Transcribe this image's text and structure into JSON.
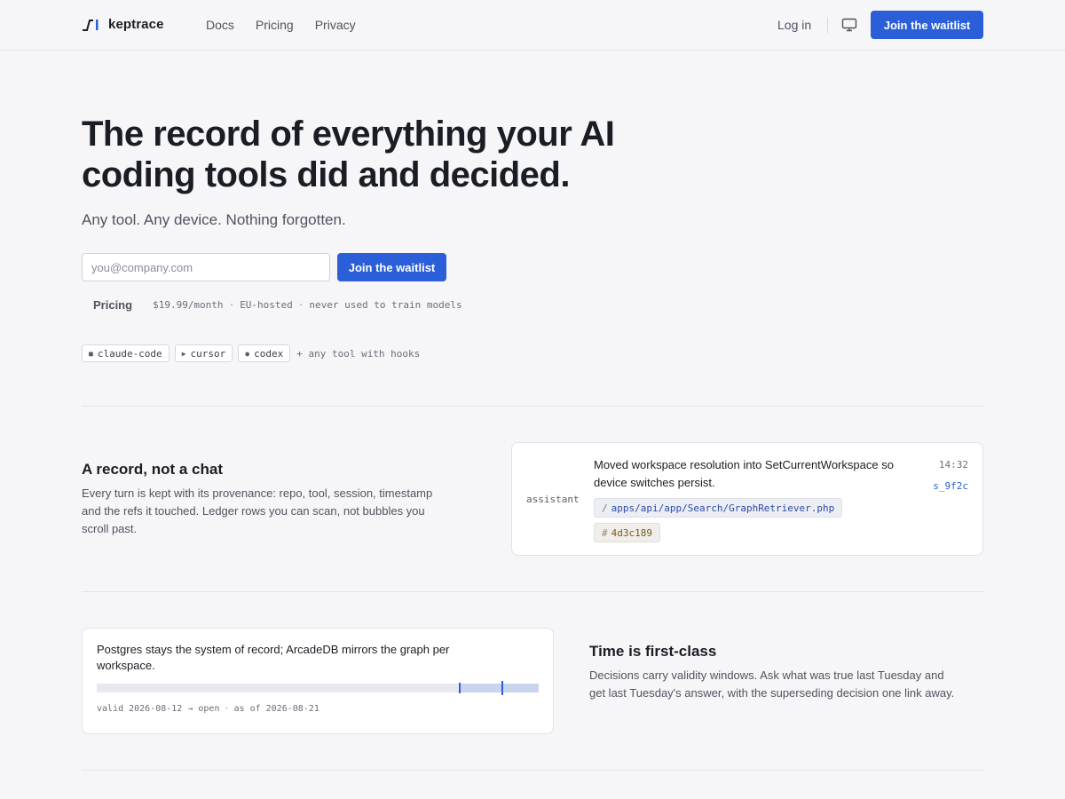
{
  "header": {
    "brand": "keptrace",
    "nav": [
      "Docs",
      "Pricing",
      "Privacy"
    ],
    "login": "Log in",
    "cta": "Join the waitlist"
  },
  "hero": {
    "title_line1": "The record of everything your AI",
    "title_line2": "coding tools did and decided.",
    "subtitle": "Any tool. Any device. Nothing forgotten.",
    "email_placeholder": "you@company.com",
    "cta": "Join the waitlist",
    "pricing_label": "Pricing",
    "pricing_items": [
      "$19.99/month",
      "EU-hosted",
      "never used to train models"
    ],
    "tools": [
      {
        "icon": "square-icon",
        "label": "claude-code"
      },
      {
        "icon": "play-icon",
        "label": "cursor"
      },
      {
        "icon": "circle-icon",
        "label": "codex"
      }
    ],
    "tools_extra": "+ any tool with hooks"
  },
  "section_record": {
    "title": "A record, not a chat",
    "body": "Every turn is kept with its provenance: repo, tool, session, timestamp and the refs it touched. Ledger rows you can scan, not bubbles you scroll past.",
    "card": {
      "role": "assistant",
      "message": "Moved workspace resolution into SetCurrentWorkspace so device switches persist.",
      "ref_path_prefix": "/",
      "ref_path": "apps/api/app/Search/GraphRetriever.php",
      "ref_hash_prefix": "#",
      "ref_hash": "4d3c189",
      "time": "14:32",
      "session": "s_9f2c"
    }
  },
  "section_time": {
    "title": "Time is first-class",
    "body": "Decisions carry validity windows. Ask what was true last Tuesday and get last Tuesday's answer, with the superseding decision one link away.",
    "card": {
      "text": "Postgres stays the system of record; ArcadeDB mirrors the graph per workspace.",
      "valid_text": "valid 2026-08-12 → open",
      "asof_text": "as of 2026-08-21",
      "validity_start_fraction": 0.822,
      "as_of_fraction": 0.918
    }
  },
  "colors": {
    "accent": "#2a5fd8",
    "background": "#f6f6f9",
    "text": "#1b1d24",
    "muted": "#50535f"
  }
}
